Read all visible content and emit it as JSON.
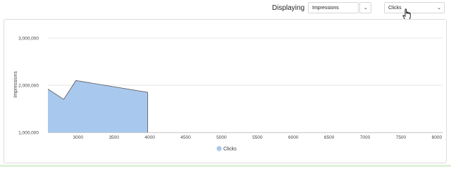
{
  "toolbar": {
    "label": "Displaying",
    "metric_select": {
      "value": "Impressions"
    },
    "secondary_select": {
      "value": "Clicks"
    }
  },
  "colors": {
    "area_fill": "#a9c8ee",
    "area_stroke": "#555555",
    "grid": "#e6e6e6"
  },
  "chart_data": {
    "type": "area",
    "ylabel": "Impressions",
    "xlabel": "",
    "ylim": [
      1000000,
      3300000
    ],
    "y_ticks": [
      {
        "value": 1000000,
        "label": "1,000,000"
      },
      {
        "value": 2000000,
        "label": "2,000,000"
      },
      {
        "value": 3000000,
        "label": "3,000,000"
      }
    ],
    "xlim": [
      2580,
      8080
    ],
    "x_ticks": [
      {
        "value": 3000,
        "label": "3000"
      },
      {
        "value": 3500,
        "label": "3500"
      },
      {
        "value": 4000,
        "label": "4000"
      },
      {
        "value": 4500,
        "label": "4500"
      },
      {
        "value": 5000,
        "label": "5000"
      },
      {
        "value": 5500,
        "label": "5500"
      },
      {
        "value": 6000,
        "label": "6000"
      },
      {
        "value": 6500,
        "label": "6500"
      },
      {
        "value": 7000,
        "label": "7000"
      },
      {
        "value": 7500,
        "label": "7500"
      },
      {
        "value": 8000,
        "label": "8000"
      }
    ],
    "grid": true,
    "legend_position": "bottom-center",
    "series": [
      {
        "name": "Clicks",
        "x": [
          2580,
          2800,
          2970,
          3970
        ],
        "y": [
          1920000,
          1700000,
          2100000,
          1850000
        ]
      }
    ]
  }
}
